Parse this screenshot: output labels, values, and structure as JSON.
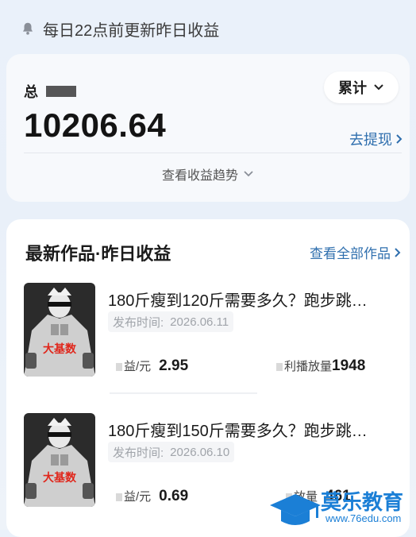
{
  "notice": {
    "text": "每日22点前更新昨日收益",
    "icon": "bell-icon"
  },
  "summary": {
    "total_label": "总",
    "amount": "10206.64",
    "period": "累计",
    "withdraw_label": "去提现",
    "trend_label": "查看收益趋势"
  },
  "works_section": {
    "title": "最新作品·昨日收益",
    "view_all_label": "查看全部作品",
    "items": [
      {
        "title": "180斤瘦到120斤需要多久？跑步跳…",
        "pub_label": "发布时间:",
        "pub_date": "2026.06.11",
        "income_label": "益/元",
        "income_value": "2.95",
        "play_label": "利播放量",
        "play_value": "1948",
        "thumb_text": "大基数"
      },
      {
        "title": "180斤瘦到150斤需要多久？跑步跳…",
        "pub_label": "发布时间:",
        "pub_date": "2026.06.10",
        "income_label": "益/元",
        "income_value": "0.69",
        "play_label": "放量",
        "play_value": "461",
        "thumb_text": "大基数"
      }
    ]
  },
  "watermark": {
    "name": "莫乐教育",
    "url": "www.76edu.com"
  },
  "colors": {
    "accent": "#2f6fae",
    "watermark": "#1b7fd6"
  }
}
